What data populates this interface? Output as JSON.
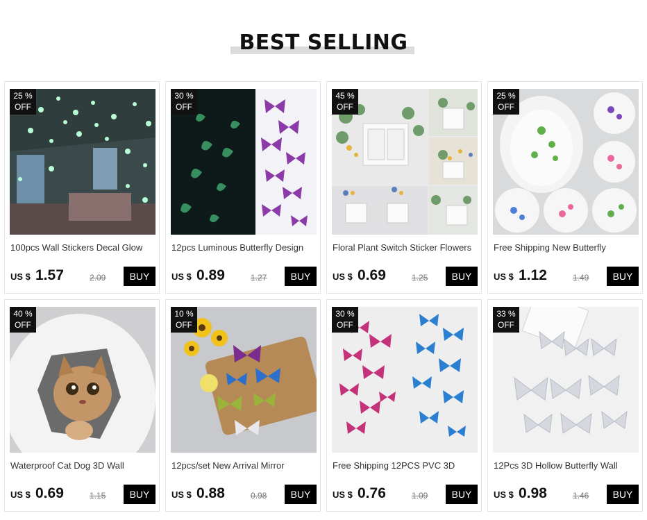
{
  "section_title": "BEST SELLING",
  "currency_label": "US $",
  "buy_label": "BUY",
  "products": [
    {
      "discount_pct": "25 %",
      "discount_off": "OFF",
      "name": "100pcs Wall Stickers Decal Glow",
      "price": "1.57",
      "old_price": "2.09"
    },
    {
      "discount_pct": "30 %",
      "discount_off": "OFF",
      "name": "12pcs Luminous Butterfly Design",
      "price": "0.89",
      "old_price": "1.27"
    },
    {
      "discount_pct": "45 %",
      "discount_off": "OFF",
      "name": "Floral Plant Switch Sticker Flowers",
      "price": "0.69",
      "old_price": "1.25"
    },
    {
      "discount_pct": "25 %",
      "discount_off": "OFF",
      "name": "Free Shipping New Butterfly",
      "price": "1.12",
      "old_price": "1.49"
    },
    {
      "discount_pct": "40 %",
      "discount_off": "OFF",
      "name": "Waterproof Cat Dog 3D Wall",
      "price": "0.69",
      "old_price": "1.15"
    },
    {
      "discount_pct": "10 %",
      "discount_off": "OFF",
      "name": "12pcs/set New Arrival Mirror",
      "price": "0.88",
      "old_price": "0.98"
    },
    {
      "discount_pct": "30 %",
      "discount_off": "OFF",
      "name": "Free Shipping 12PCS PVC 3D",
      "price": "0.76",
      "old_price": "1.09"
    },
    {
      "discount_pct": "33 %",
      "discount_off": "OFF",
      "name": "12Pcs 3D Hollow Butterfly Wall",
      "price": "0.98",
      "old_price": "1.46"
    }
  ]
}
